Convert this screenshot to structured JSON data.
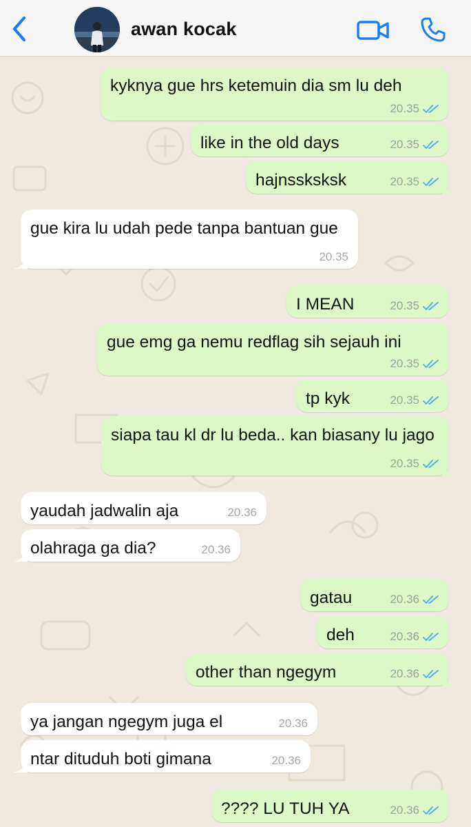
{
  "contact": {
    "name": "awan kocak"
  },
  "icons": {
    "back": "chevron-left-icon",
    "video": "video-camera-icon",
    "call": "phone-icon",
    "read": "double-check-icon"
  },
  "colors": {
    "accent": "#1a7cf4",
    "outgoing_bubble": "#dcf8c6",
    "incoming_bubble": "#ffffff",
    "read_check": "#4fa9e6",
    "wallpaper": "#efe9df"
  },
  "messages": [
    {
      "direction": "out",
      "text": "kyknya gue hrs ketemuin dia sm lu deh",
      "time": "20.35",
      "read": true
    },
    {
      "direction": "out",
      "text": "like in the old days",
      "time": "20.35",
      "read": true
    },
    {
      "direction": "out",
      "text": "hajnssksksk",
      "time": "20.35",
      "read": true
    },
    {
      "direction": "in",
      "text": "gue kira lu udah pede tanpa bantuan gue",
      "time": "20.35"
    },
    {
      "direction": "out",
      "text": "I MEAN",
      "time": "20.35",
      "read": true
    },
    {
      "direction": "out",
      "text": "gue emg ga nemu redflag sih sejauh ini",
      "time": "20.35",
      "read": true
    },
    {
      "direction": "out",
      "text": "tp kyk",
      "time": "20.35",
      "read": true
    },
    {
      "direction": "out",
      "text": "siapa tau kl dr lu beda.. kan biasany lu jago",
      "time": "20.35",
      "read": true
    },
    {
      "direction": "in",
      "text": "yaudah jadwalin aja",
      "time": "20.36"
    },
    {
      "direction": "in",
      "text": "olahraga ga dia?",
      "time": "20.36"
    },
    {
      "direction": "out",
      "text": "gatau",
      "time": "20.36",
      "read": true
    },
    {
      "direction": "out",
      "text": "deh",
      "time": "20.36",
      "read": true
    },
    {
      "direction": "out",
      "text": "other than ngegym",
      "time": "20.36",
      "read": true
    },
    {
      "direction": "in",
      "text": "ya jangan ngegym juga el",
      "time": "20.36"
    },
    {
      "direction": "in",
      "text": "ntar dituduh boti gimana",
      "time": "20.36"
    },
    {
      "direction": "out",
      "text": "???? LU TUH YA",
      "time": "20.36",
      "read": true
    }
  ]
}
